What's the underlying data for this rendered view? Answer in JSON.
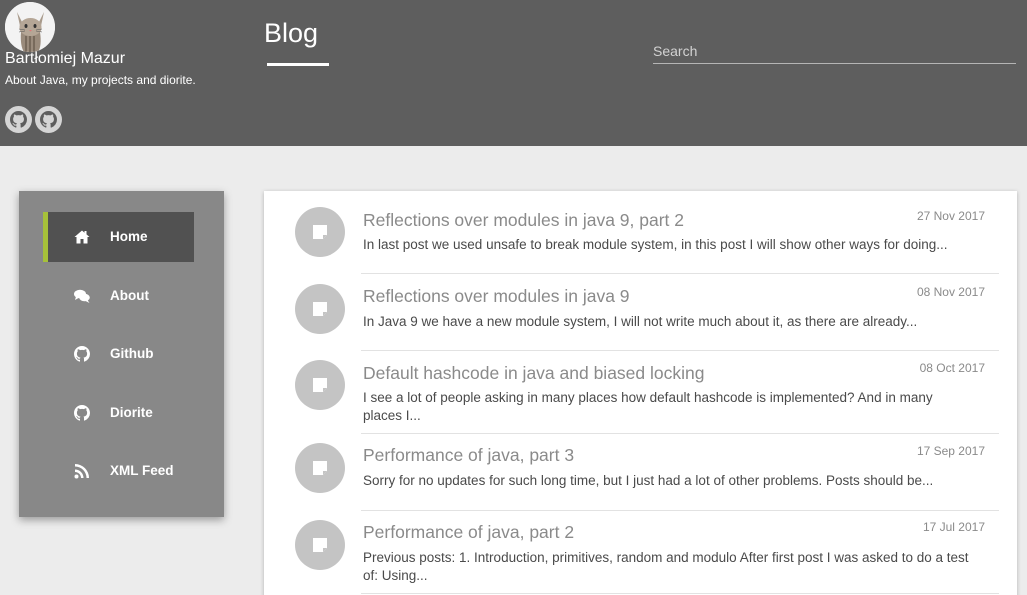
{
  "header": {
    "author_name": "Bartłomiej Mazur",
    "tagline": "About Java, my projects and diorite.",
    "title": "Blog",
    "search_placeholder": "Search",
    "social": [
      "github-icon",
      "github-icon"
    ]
  },
  "sidebar": {
    "items": [
      {
        "label": "Home",
        "icon": "home-icon",
        "active": true
      },
      {
        "label": "About",
        "icon": "comments-icon",
        "active": false
      },
      {
        "label": "Github",
        "icon": "github-icon",
        "active": false
      },
      {
        "label": "Diorite",
        "icon": "github-icon",
        "active": false
      },
      {
        "label": "XML Feed",
        "icon": "rss-icon",
        "active": false
      }
    ]
  },
  "posts": [
    {
      "title": "Reflections over modules in java 9, part 2",
      "date": "27 Nov 2017",
      "excerpt": "In last post we used unsafe to break module system, in this post I will show other ways for doing..."
    },
    {
      "title": "Reflections over modules in java 9",
      "date": "08 Nov 2017",
      "excerpt": "In Java 9 we have a new module system, I will not write much about it, as there are already..."
    },
    {
      "title": "Default hashcode in java and biased locking",
      "date": "08 Oct 2017",
      "excerpt": "I see a lot of people asking in many places how default hashcode is implemented? And in many places I..."
    },
    {
      "title": "Performance of java, part 3",
      "date": "17 Sep 2017",
      "excerpt": "Sorry for no updates for such long time, but I just had a lot of other problems. Posts should be..."
    },
    {
      "title": "Performance of java, part 2",
      "date": "17 Jul 2017",
      "excerpt": "Previous posts: 1. Introduction, primitives, random and modulo After first post I was asked to do a test of: Using..."
    }
  ],
  "colors": {
    "header_bg": "#5e5e5e",
    "sidebar_bg": "#888888",
    "active_item_bg": "#515151",
    "active_accent": "#a6c13a",
    "page_bg": "#ececec"
  }
}
